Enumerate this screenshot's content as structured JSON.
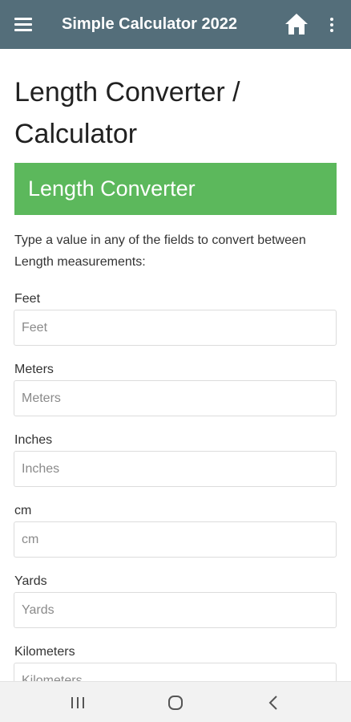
{
  "app_bar": {
    "title": "Simple Calculator 2022",
    "background": "#546e7a",
    "icons": [
      "menu-icon",
      "home-icon",
      "more-vert-icon"
    ]
  },
  "page": {
    "title": "Length Converter / Calculator",
    "banner_text": "Length Converter",
    "banner_color": "#5cb85c",
    "intro": "Type a value in any of the fields to convert between Length measurements:"
  },
  "fields": [
    {
      "label": "Feet",
      "placeholder": "Feet",
      "value": ""
    },
    {
      "label": "Meters",
      "placeholder": "Meters",
      "value": ""
    },
    {
      "label": "Inches",
      "placeholder": "Inches",
      "value": ""
    },
    {
      "label": "cm",
      "placeholder": "cm",
      "value": ""
    },
    {
      "label": "Yards",
      "placeholder": "Yards",
      "value": ""
    },
    {
      "label": "Kilometers",
      "placeholder": "Kilometers",
      "value": ""
    }
  ],
  "system_nav": {
    "icons": [
      "recent-apps-icon",
      "home-circle-icon",
      "back-icon"
    ]
  }
}
